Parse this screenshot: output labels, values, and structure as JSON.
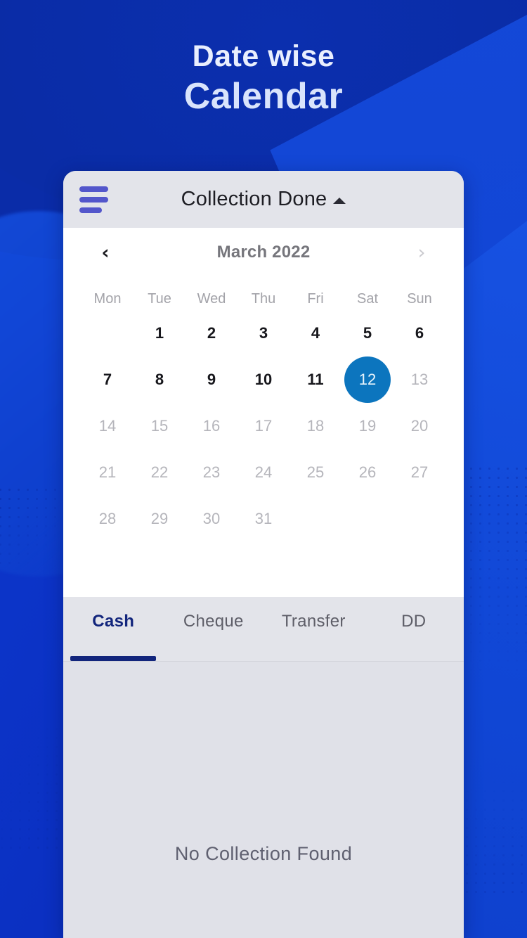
{
  "hero": {
    "line1": "Date wise",
    "line2": "Calendar"
  },
  "appbar": {
    "menu_icon": "hamburger-menu-icon",
    "title": "Collection Done",
    "caret_icon": "caret-up-icon"
  },
  "calendar": {
    "prev_icon": "‹",
    "next_icon": "›",
    "month_label": "March 2022",
    "weekdays": [
      "Mon",
      "Tue",
      "Wed",
      "Thu",
      "Fri",
      "Sat",
      "Sun"
    ],
    "selected_day": "12",
    "selected_color": "#0C75BE",
    "weeks": [
      [
        {
          "label": "",
          "state": "empty"
        },
        {
          "label": "1",
          "state": "past"
        },
        {
          "label": "2",
          "state": "past"
        },
        {
          "label": "3",
          "state": "past"
        },
        {
          "label": "4",
          "state": "past"
        },
        {
          "label": "5",
          "state": "past"
        },
        {
          "label": "6",
          "state": "past"
        }
      ],
      [
        {
          "label": "7",
          "state": "past"
        },
        {
          "label": "8",
          "state": "past"
        },
        {
          "label": "9",
          "state": "past"
        },
        {
          "label": "10",
          "state": "past"
        },
        {
          "label": "11",
          "state": "past"
        },
        {
          "label": "12",
          "state": "selected"
        },
        {
          "label": "13",
          "state": "future"
        }
      ],
      [
        {
          "label": "14",
          "state": "future"
        },
        {
          "label": "15",
          "state": "future"
        },
        {
          "label": "16",
          "state": "future"
        },
        {
          "label": "17",
          "state": "future"
        },
        {
          "label": "18",
          "state": "future"
        },
        {
          "label": "19",
          "state": "future"
        },
        {
          "label": "20",
          "state": "future"
        }
      ],
      [
        {
          "label": "21",
          "state": "future"
        },
        {
          "label": "22",
          "state": "future"
        },
        {
          "label": "23",
          "state": "future"
        },
        {
          "label": "24",
          "state": "future"
        },
        {
          "label": "25",
          "state": "future"
        },
        {
          "label": "26",
          "state": "future"
        },
        {
          "label": "27",
          "state": "future"
        }
      ],
      [
        {
          "label": "28",
          "state": "future"
        },
        {
          "label": "29",
          "state": "future"
        },
        {
          "label": "30",
          "state": "future"
        },
        {
          "label": "31",
          "state": "future"
        },
        {
          "label": "",
          "state": "empty"
        },
        {
          "label": "",
          "state": "empty"
        },
        {
          "label": "",
          "state": "empty"
        }
      ]
    ]
  },
  "tabs": {
    "active_index": 0,
    "active_color": "#12257C",
    "items": [
      {
        "label": "Cash"
      },
      {
        "label": "Cheque"
      },
      {
        "label": "Transfer"
      },
      {
        "label": "DD"
      }
    ]
  },
  "content": {
    "empty_message": "No Collection Found"
  },
  "theme": {
    "background_blue": "#0C34C8",
    "background_blue_light": "#1449DA",
    "background_navy": "#0A2BA4",
    "card_bg": "#E0E1E8",
    "appbar_bg": "#E3E4EA",
    "menu_icon_color": "#5356CB"
  }
}
